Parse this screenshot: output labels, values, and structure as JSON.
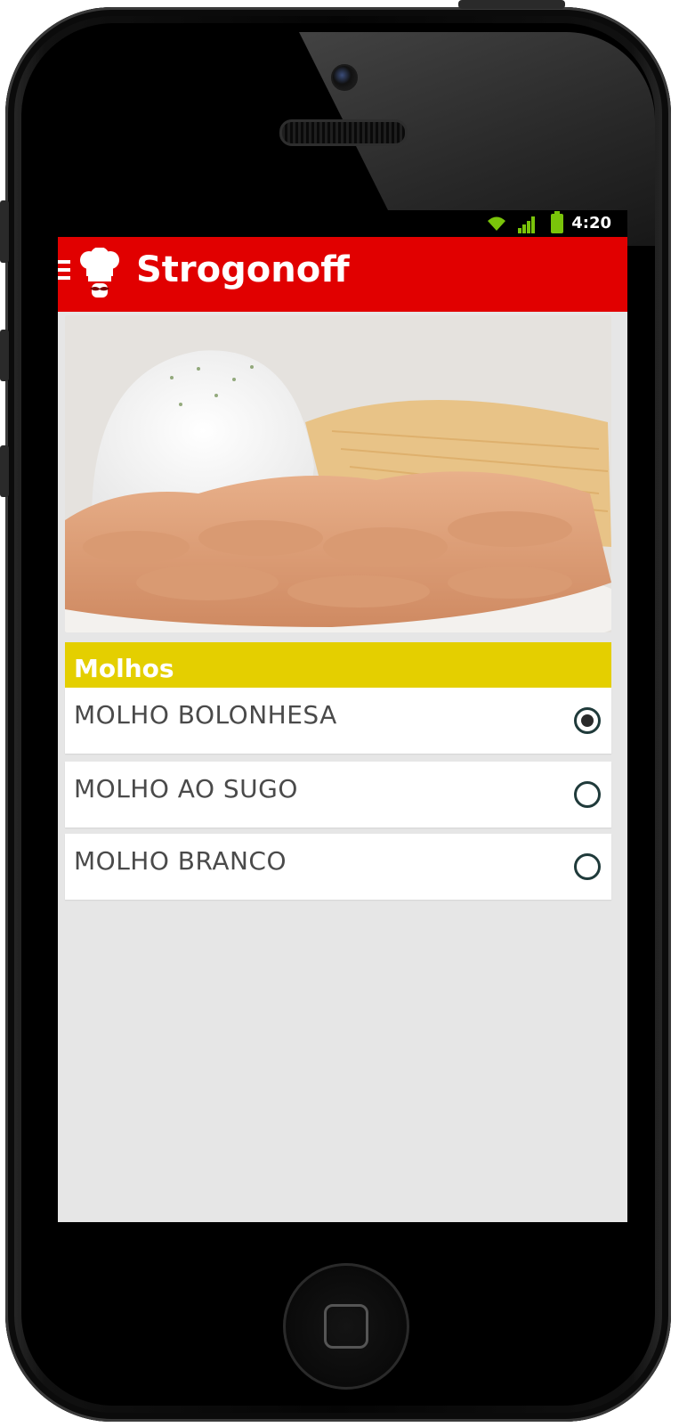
{
  "statusbar": {
    "time": "4:20",
    "icons": [
      "wifi-icon",
      "signal-icon",
      "battery-icon"
    ]
  },
  "appbar": {
    "title": "Strogonoff",
    "icons": [
      "menu-icon",
      "chef-hat-logo"
    ],
    "color": "#e10000"
  },
  "section": {
    "title": "Molhos",
    "color": "#e4cf00"
  },
  "options": [
    {
      "label": "MOLHO BOLONHESA",
      "selected": true
    },
    {
      "label": "MOLHO AO SUGO",
      "selected": false
    },
    {
      "label": "MOLHO BRANCO",
      "selected": false
    }
  ]
}
